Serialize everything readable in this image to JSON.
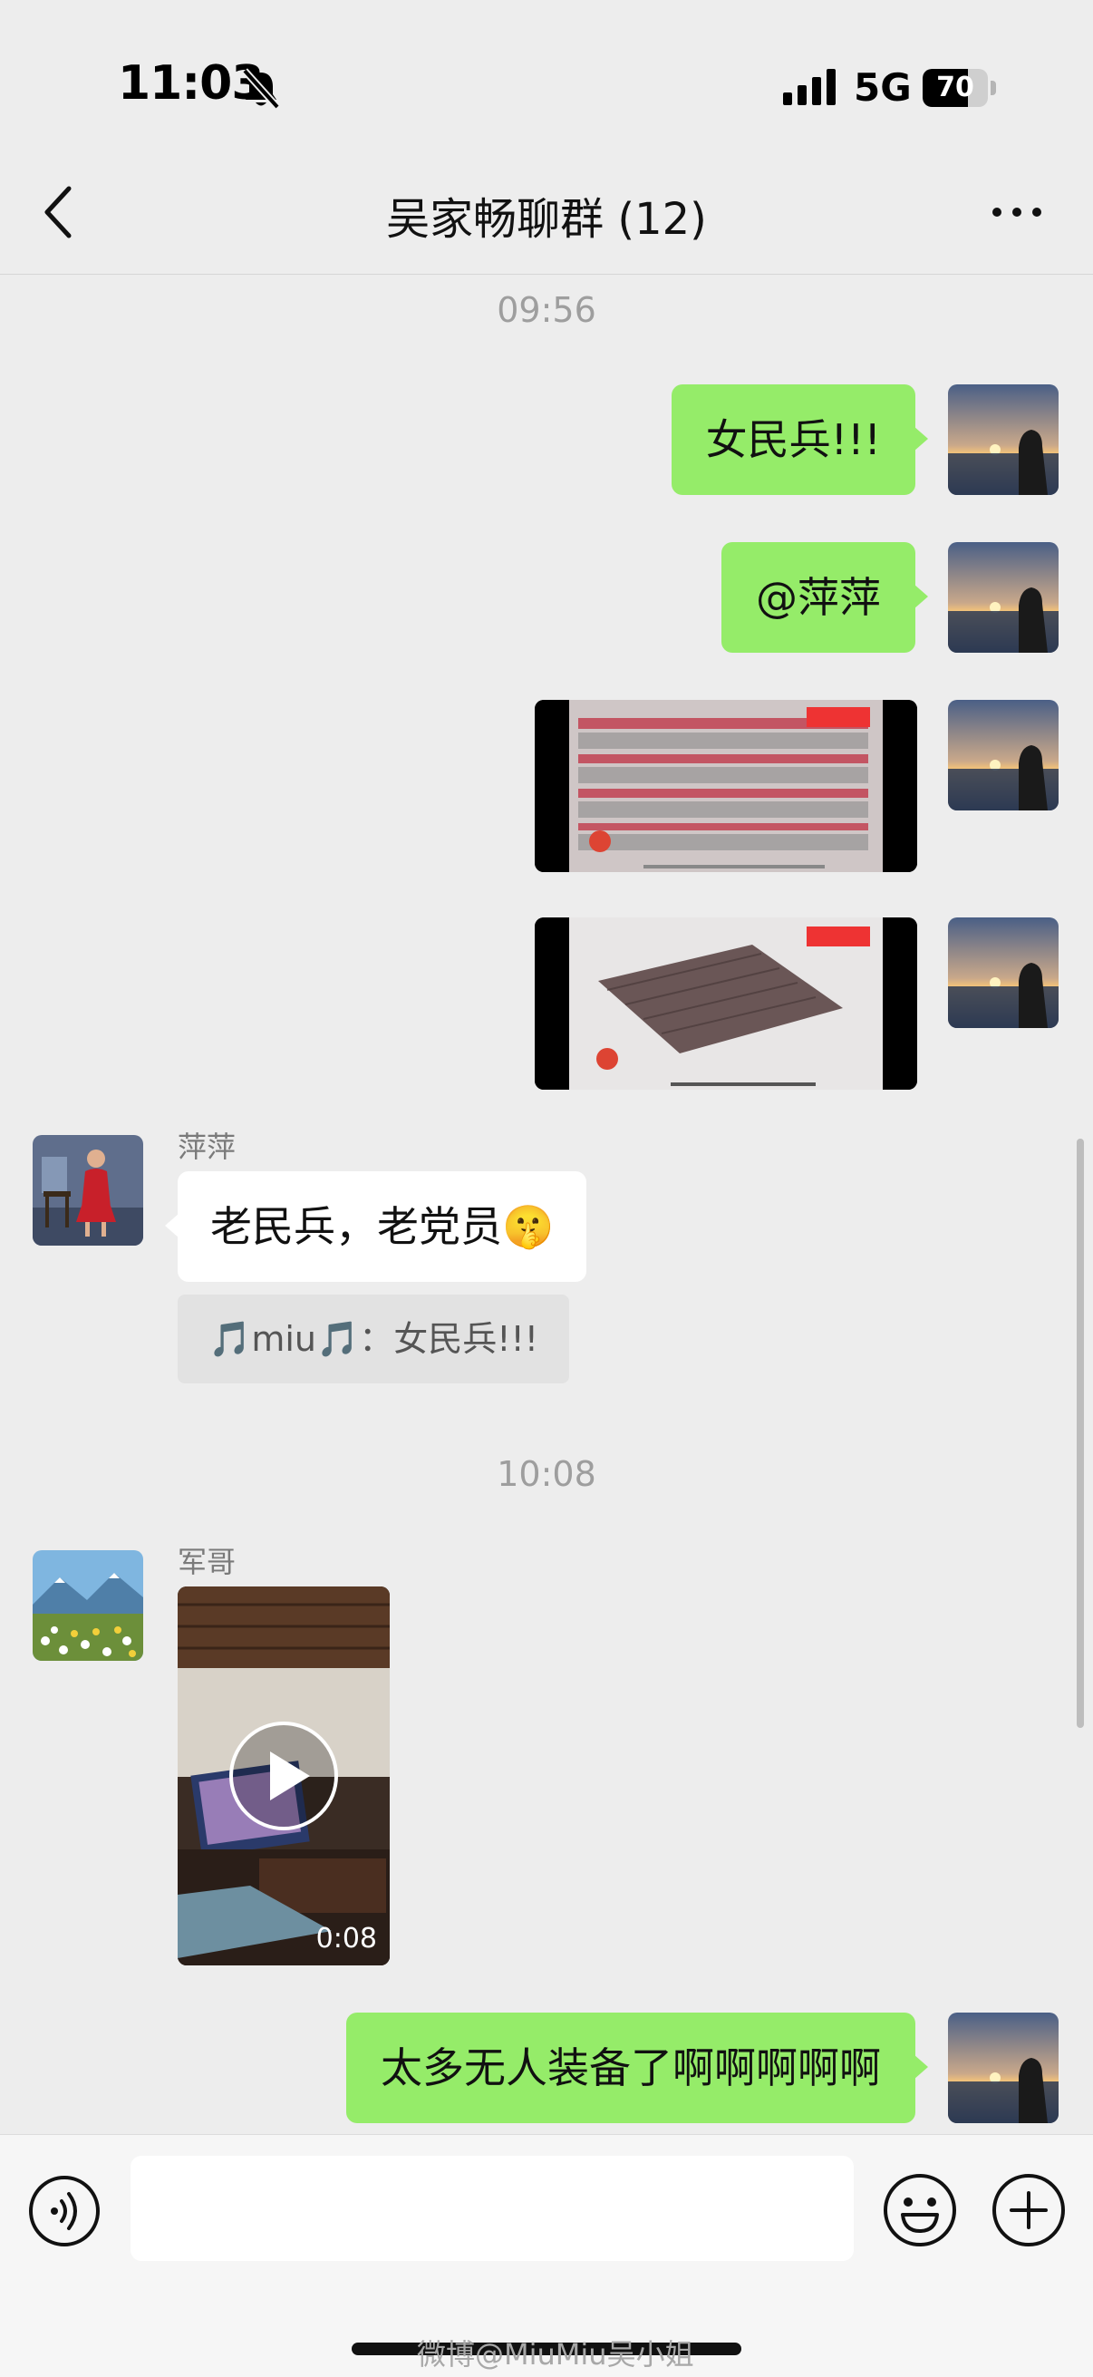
{
  "status_bar": {
    "time": "11:03",
    "network": "5G",
    "battery": "70",
    "battery_level": 0.7
  },
  "nav": {
    "title": "吴家畅聊群 (12)"
  },
  "messages": {
    "ts1": "09:56",
    "out1": "女民兵!!!",
    "out2": "@萍萍",
    "sender_pingping": "萍萍",
    "in1": "老民兵，老党员🤫",
    "quote1": "🎵miu🎵：女民兵!!!",
    "ts2": "10:08",
    "sender_junge": "军哥",
    "video_duration": "0:08",
    "out3": "太多无人装备了啊啊啊啊啊"
  },
  "input": {
    "placeholder": ""
  },
  "watermark": "微博@MiuMiu吴小姐",
  "icons": {
    "back": "chevron-left-icon",
    "more": "ellipsis-icon",
    "voice": "voice-icon",
    "emoji": "emoji-icon",
    "add": "plus-circle-icon",
    "play": "play-icon"
  },
  "colors": {
    "bubble_out": "#95ec69",
    "bubble_in": "#ffffff",
    "background": "#ededed"
  }
}
